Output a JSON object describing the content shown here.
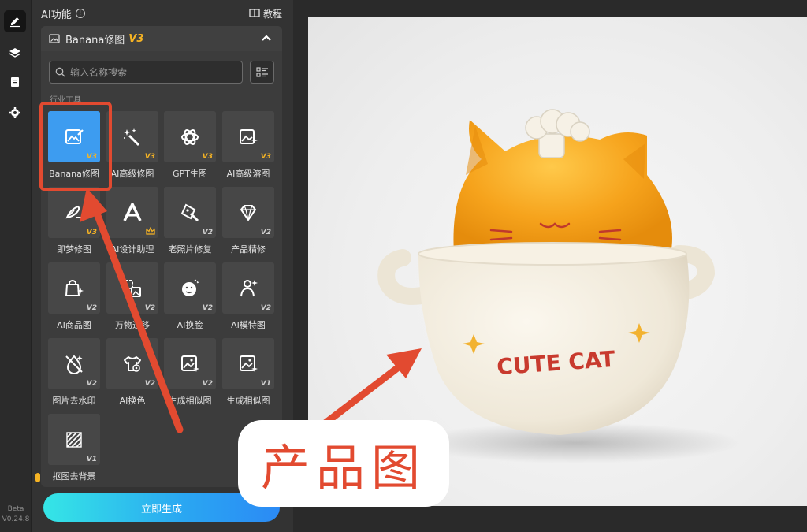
{
  "rail": {
    "version_line1": "Beta",
    "version_line2": "V0.24.8"
  },
  "panel": {
    "title": "AI功能",
    "info_symbol": "!",
    "tutorial_label": "教程"
  },
  "module": {
    "title": "Banana修图",
    "version": "V3"
  },
  "search": {
    "placeholder": "输入名称搜索"
  },
  "section_label": "行业工具",
  "tools": [
    {
      "label": "Banana修图",
      "version": "V3",
      "icon": "image-edit-icon"
    },
    {
      "label": "AI高级修图",
      "version": "V3",
      "icon": "magic-wand-icon"
    },
    {
      "label": "GPT生图",
      "version": "V3",
      "icon": "gpt-knot-icon"
    },
    {
      "label": "AI高级溶图",
      "version": "V3",
      "icon": "image-sparkle-icon"
    },
    {
      "label": "即梦修图",
      "version": "V3",
      "icon": "brush-icon"
    },
    {
      "label": "AI设计助理",
      "version": "",
      "icon": "design-a-icon"
    },
    {
      "label": "老照片修复",
      "version": "V2",
      "icon": "photo-repair-icon"
    },
    {
      "label": "产品精修",
      "version": "V2",
      "icon": "gem-icon"
    },
    {
      "label": "AI商品图",
      "version": "V2",
      "icon": "shopping-bag-icon"
    },
    {
      "label": "万物迁移",
      "version": "V2",
      "icon": "transfer-icon"
    },
    {
      "label": "AI换脸",
      "version": "V2",
      "icon": "face-swap-icon"
    },
    {
      "label": "AI模特图",
      "version": "V2",
      "icon": "model-person-icon"
    },
    {
      "label": "图片去水印",
      "version": "V2",
      "icon": "no-watermark-icon"
    },
    {
      "label": "AI换色",
      "version": "V2",
      "icon": "shirt-color-icon"
    },
    {
      "label": "生成相似图",
      "version": "V2",
      "icon": "similar-image-icon"
    },
    {
      "label": "生成相似图",
      "version": "V1",
      "icon": "similar-image-icon"
    },
    {
      "label": "抠图去背景",
      "version": "V1",
      "icon": "remove-bg-icon"
    }
  ],
  "generate_label": "立即生成",
  "annotation": {
    "text": "产品图"
  },
  "product": {
    "print_text": "CUTE CAT"
  },
  "colors": {
    "accent": "#3d9cf0",
    "annotation_red": "#e24a30",
    "version_gold": "#f5b324"
  }
}
